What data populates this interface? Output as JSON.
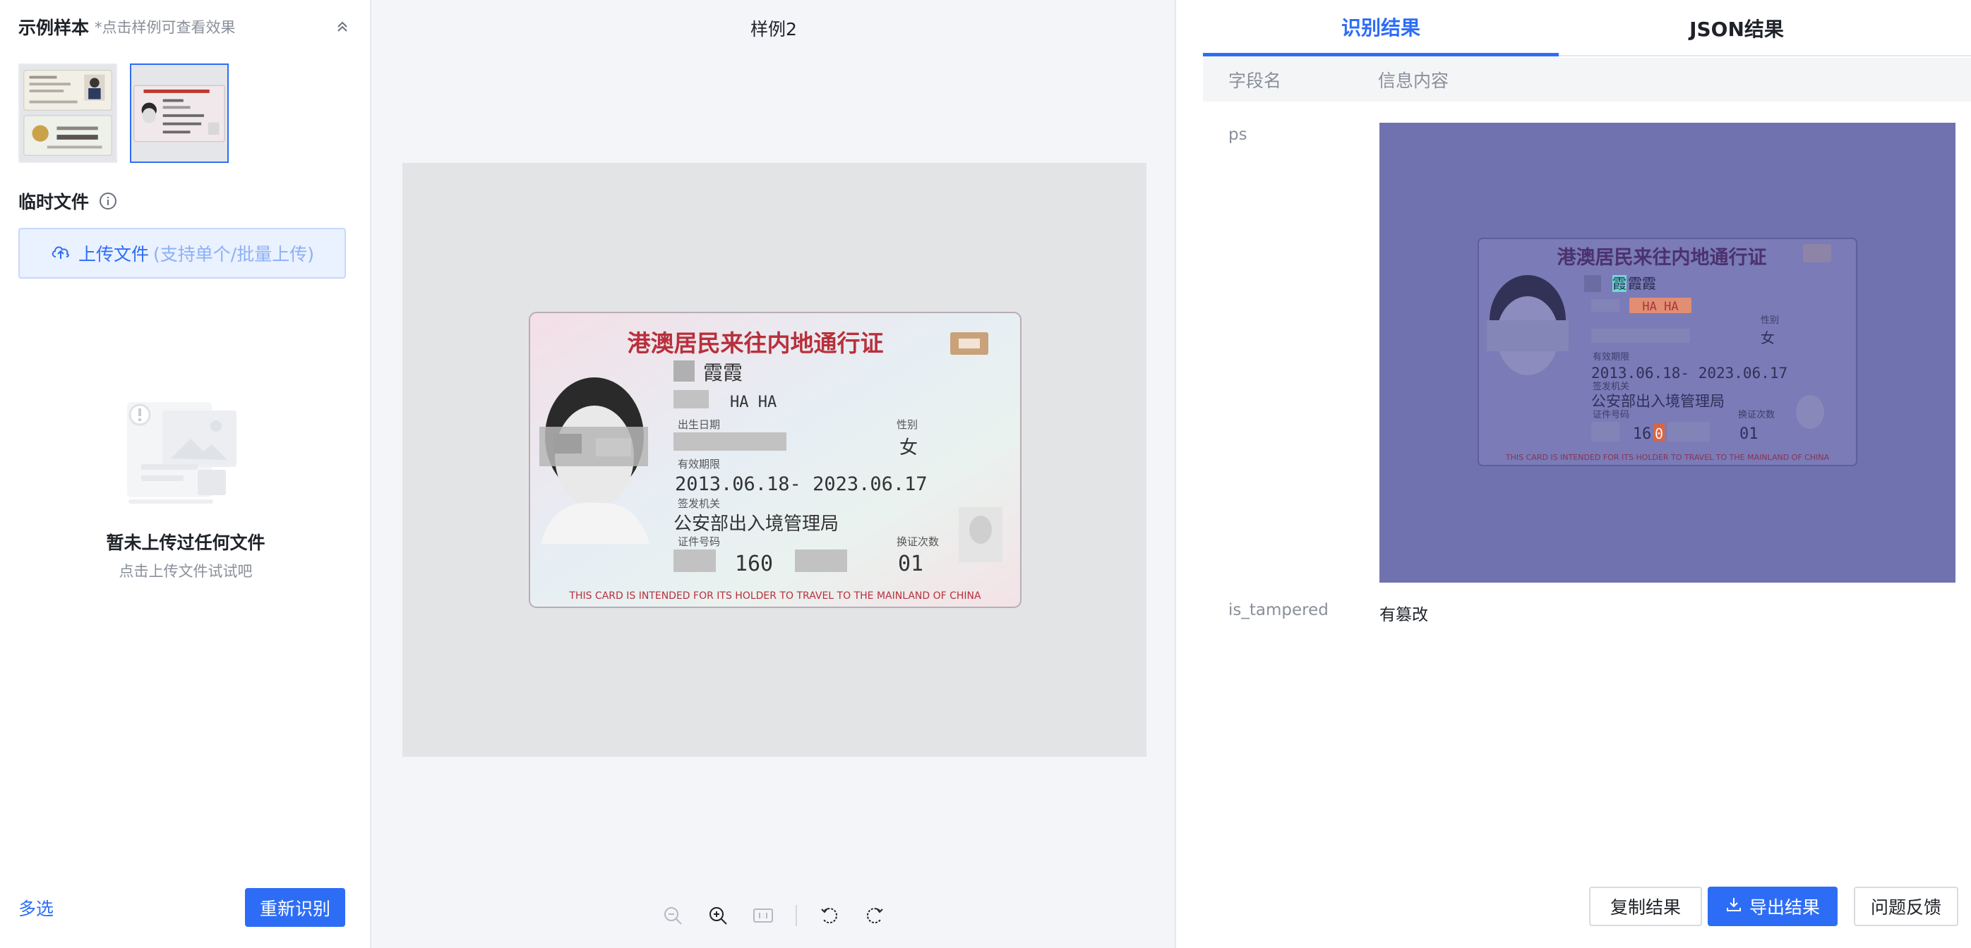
{
  "left": {
    "sample_title": "示例样本",
    "sample_hint": "*点击样例可查看效果",
    "temp_title": "临时文件",
    "upload_label": "上传文件",
    "upload_hint": "(支持单个/批量上传)",
    "empty_title": "暂未上传过任何文件",
    "empty_subtitle": "点击上传文件试试吧",
    "multi_select": "多选",
    "re_recognize": "重新识别"
  },
  "middle": {
    "title": "样例2"
  },
  "card": {
    "title": "港澳居民来往内地通行证",
    "name_cn": "霞霞",
    "name_en": "HA HA",
    "dob_label": "出生日期",
    "sex_label": "性别",
    "sex": "女",
    "validity_label": "有效期限",
    "validity": "2013.06.18- 2023.06.17",
    "authority_label": "签发机关",
    "authority": "公安部出入境管理局",
    "number_label": "证件号码",
    "number": "160",
    "count_label": "换证次数",
    "count": "01",
    "footer": "THIS CARD IS INTENDED FOR ITS HOLDER TO TRAVEL TO THE MAINLAND OF CHINA",
    "hl_name": "霞",
    "hl_en": "HA HA",
    "hl_num": "16",
    "hl_num_mark": "0"
  },
  "right": {
    "tab_result": "识别结果",
    "tab_json": "JSON结果",
    "col_field": "字段名",
    "col_value": "信息内容",
    "rows": [
      {
        "field": "ps"
      },
      {
        "field": "is_tampered",
        "value": "有篡改"
      }
    ],
    "copy": "复制结果",
    "export": "导出结果",
    "feedback": "问题反馈"
  },
  "colors": {
    "accent": "#2d6df6",
    "tamper_overlay": "#7072b0"
  }
}
